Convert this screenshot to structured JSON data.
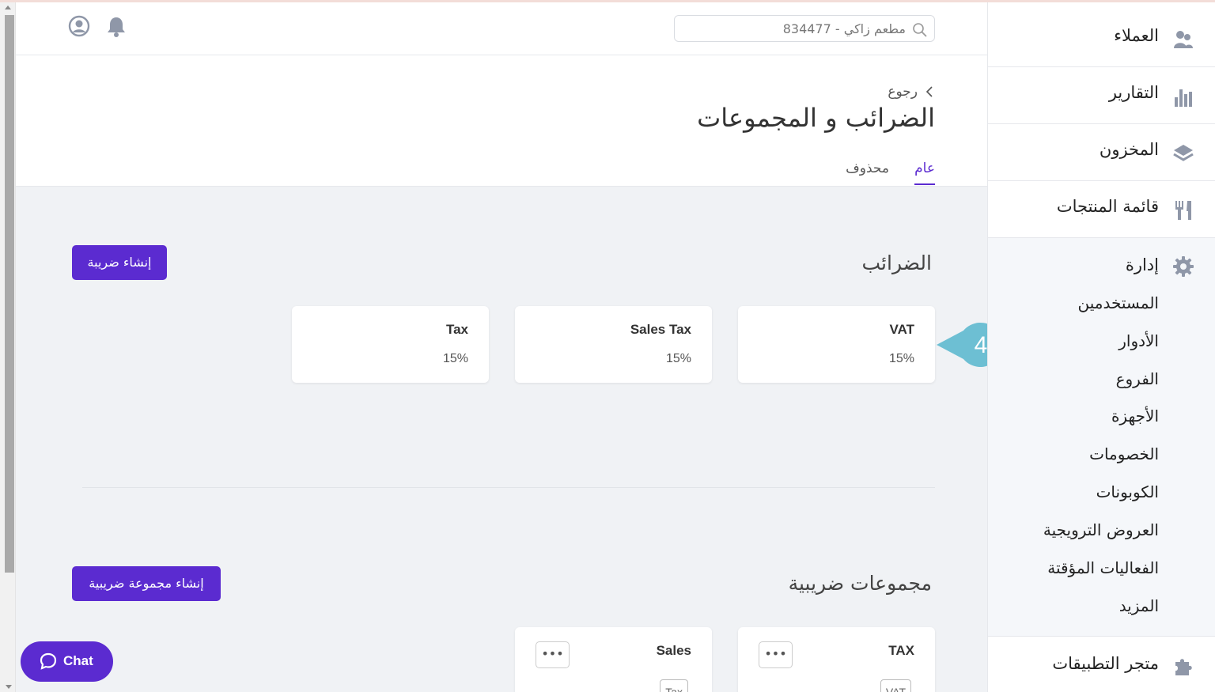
{
  "header": {
    "search_value": "مطعم زاكي - 834477"
  },
  "page": {
    "back_label": "رجوع",
    "title": "الضرائب و المجموعات",
    "tabs": [
      {
        "label": "عام",
        "active": true
      },
      {
        "label": "محذوف",
        "active": false
      }
    ]
  },
  "taxes": {
    "title": "الضرائب",
    "create_button": "إنشاء ضريبة",
    "items": [
      {
        "name": "VAT",
        "rate": "15%"
      },
      {
        "name": "Sales Tax",
        "rate": "15%"
      },
      {
        "name": "Tax",
        "rate": "15%"
      }
    ]
  },
  "tax_groups": {
    "title": "مجموعات ضريبية",
    "create_button": "إنشاء مجموعة ضريبية",
    "items": [
      {
        "name": "TAX",
        "chip": "VAT",
        "menu": "•••"
      },
      {
        "name": "Sales",
        "chip": "Tax",
        "menu": "•••"
      }
    ]
  },
  "callout": {
    "number": "4",
    "color": "#6dbfd3"
  },
  "sidebar": {
    "items": [
      {
        "label": "العملاء",
        "icon": "customers-icon"
      },
      {
        "label": "التقارير",
        "icon": "reports-icon"
      },
      {
        "label": "المخزون",
        "icon": "inventory-icon"
      },
      {
        "label": "قائمة المنتجات",
        "icon": "menu-icon"
      }
    ],
    "admin": {
      "label": "إدارة",
      "icon": "gear-icon",
      "sub_items": [
        "المستخدمين",
        "الأدوار",
        "الفروع",
        "الأجهزة",
        "الخصومات",
        "الكوبونات",
        "العروض الترويجية",
        "الفعاليات المؤقتة",
        "المزيد"
      ]
    },
    "store": {
      "label": "متجر التطبيقات",
      "icon": "puzzle-icon"
    }
  },
  "chat": {
    "label": "Chat"
  },
  "colors": {
    "primary": "#5b2bd0",
    "background": "#f0f2f5",
    "sidebar_icon": "#8f97a8"
  }
}
